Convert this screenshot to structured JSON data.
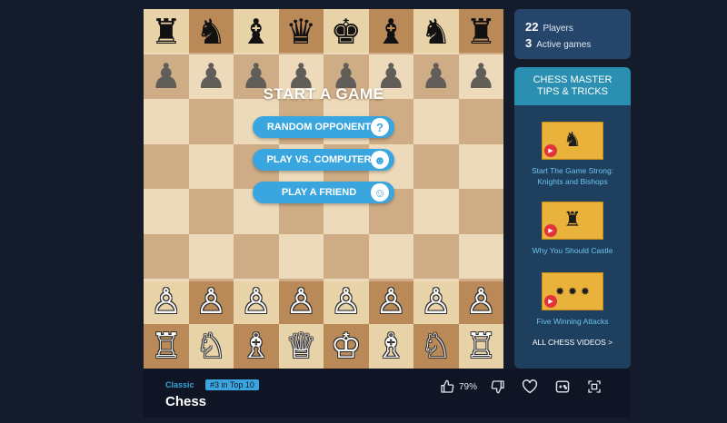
{
  "menu": {
    "title": "START A GAME",
    "buttons": [
      {
        "label": "RANDOM OPPONENT",
        "icon": "question-icon",
        "glyph": "?"
      },
      {
        "label": "PLAY VS. COMPUTER",
        "icon": "robot-icon",
        "glyph": "☻"
      },
      {
        "label": "PLAY A FRIEND",
        "icon": "friend-icon",
        "glyph": "☺"
      }
    ]
  },
  "board": {
    "light_color": "#e8d2a8",
    "dark_color": "#b98a57",
    "ranks": [
      [
        "♜",
        "♞",
        "♝",
        "♛",
        "♚",
        "♝",
        "♞",
        "♜"
      ],
      [
        "♟",
        "♟",
        "♟",
        "♟",
        "♟",
        "♟",
        "♟",
        "♟"
      ],
      [
        "",
        "",
        "",
        "",
        "",
        "",
        "",
        ""
      ],
      [
        "",
        "",
        "",
        "",
        "",
        "",
        "",
        ""
      ],
      [
        "",
        "",
        "",
        "",
        "",
        "",
        "",
        ""
      ],
      [
        "",
        "",
        "",
        "",
        "",
        "",
        "",
        ""
      ],
      [
        "♙",
        "♙",
        "♙",
        "♙",
        "♙",
        "♙",
        "♙",
        "♙"
      ],
      [
        "♖",
        "♘",
        "♗",
        "♕",
        "♔",
        "♗",
        "♘",
        "♖"
      ]
    ]
  },
  "stats": {
    "players_count": "22",
    "players_label": "Players",
    "games_count": "3",
    "games_label": "Active games"
  },
  "tips": {
    "header_line1": "CHESS MASTER",
    "header_line2": "TIPS & TRICKS",
    "items": [
      {
        "title": "Start The Game Strong: Knights and Bishops",
        "art": "♞"
      },
      {
        "title": "Why You Should Castle",
        "art": "♜"
      },
      {
        "title": "Five Winning Attacks",
        "art": "✹ ✹ ✹"
      }
    ],
    "all_videos": "ALL CHESS VIDEOS >"
  },
  "footer": {
    "category": "Classic",
    "rank": "#3 in Top 10",
    "title": "Chess",
    "like_percent": "79%",
    "icons": [
      "thumbs-up-icon",
      "thumbs-down-icon",
      "heart-icon",
      "gamepad-icon",
      "fullscreen-icon"
    ]
  },
  "colors": {
    "accent": "#3aa6e0",
    "page_bg": "#141b2b",
    "sidebar_bg": "#1e3f5e",
    "tips_header_bg": "#2a8fb0",
    "thumb_bg": "#e9b23a",
    "play_red": "#e0333a"
  }
}
